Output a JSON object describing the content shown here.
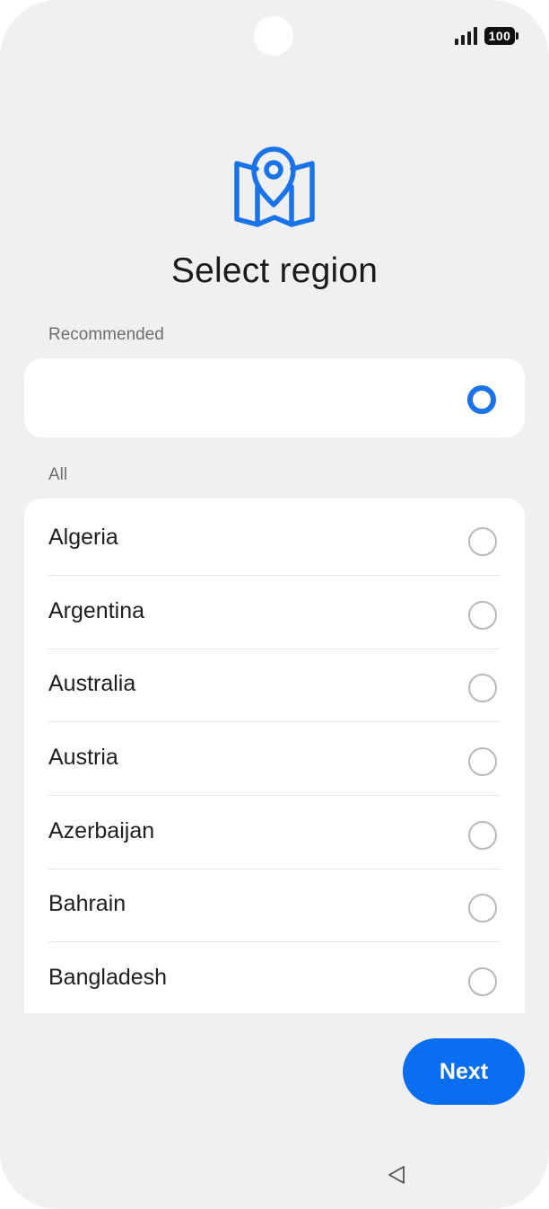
{
  "status_bar": {
    "battery": "100",
    "signal_icon": "signal-bars-icon"
  },
  "header": {
    "icon": "map-pin-icon",
    "title": "Select region"
  },
  "recommended": {
    "section_label": "Recommended",
    "item_label": "",
    "selected": true,
    "accent_color": "#1a73e8"
  },
  "all": {
    "section_label": "All",
    "regions": [
      {
        "label": "Algeria",
        "selected": false
      },
      {
        "label": "Argentina",
        "selected": false
      },
      {
        "label": "Australia",
        "selected": false
      },
      {
        "label": "Austria",
        "selected": false
      },
      {
        "label": "Azerbaijan",
        "selected": false
      },
      {
        "label": "Bahrain",
        "selected": false
      },
      {
        "label": "Bangladesh",
        "selected": false
      }
    ]
  },
  "footer": {
    "next_label": "Next",
    "button_color": "#0b6ef0"
  },
  "nav_bar": {
    "back_icon": "back-triangle-icon"
  }
}
